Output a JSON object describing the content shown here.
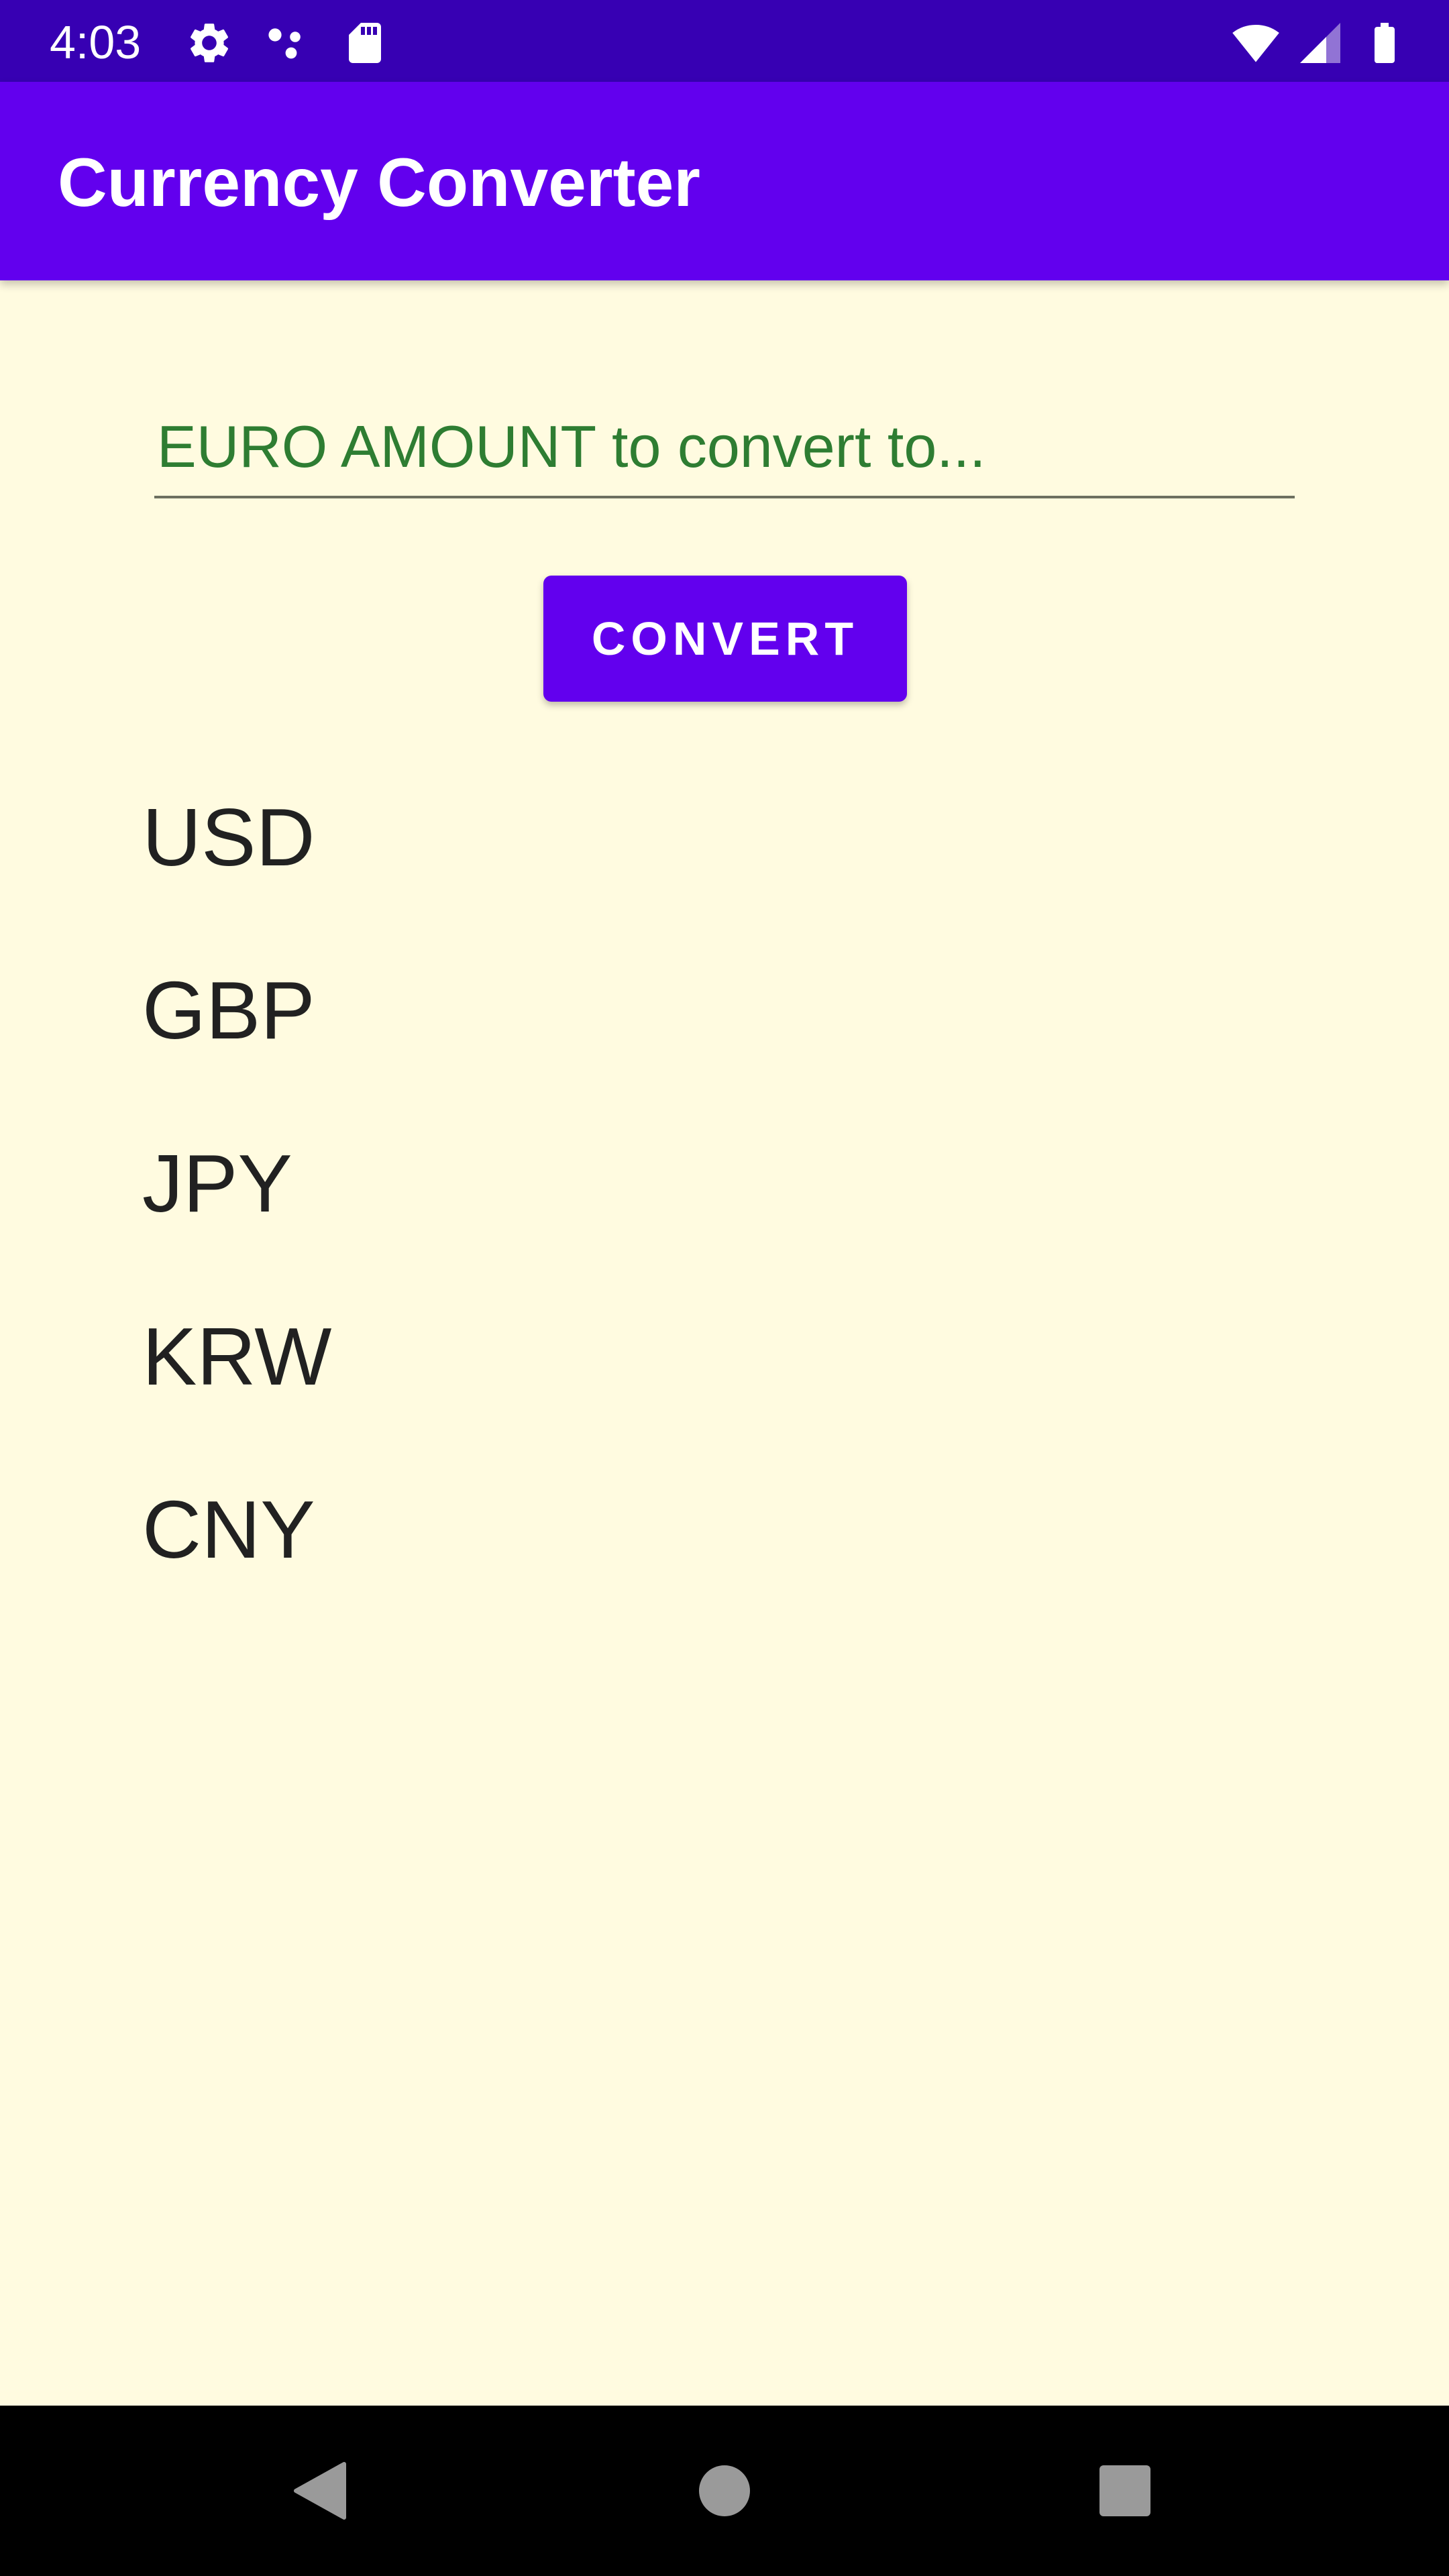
{
  "status_bar": {
    "time": "4:03",
    "icons": [
      "settings-icon",
      "dots-icon",
      "sd-card-icon",
      "wifi-icon",
      "signal-icon",
      "battery-icon"
    ]
  },
  "app_bar": {
    "title": "Currency Converter"
  },
  "converter": {
    "input_value": "",
    "input_placeholder": "EURO AMOUNT to convert to...",
    "convert_label": "CONVERT"
  },
  "currencies": [
    "USD",
    "GBP",
    "JPY",
    "KRW",
    "CNY"
  ],
  "nav_bar": {
    "icons": [
      "back-icon",
      "home-icon",
      "recents-icon"
    ]
  },
  "colors": {
    "status_bar": "#3700B3",
    "primary": "#6200EE",
    "background": "#FFFBE0",
    "input_text": "#2E7D32"
  }
}
